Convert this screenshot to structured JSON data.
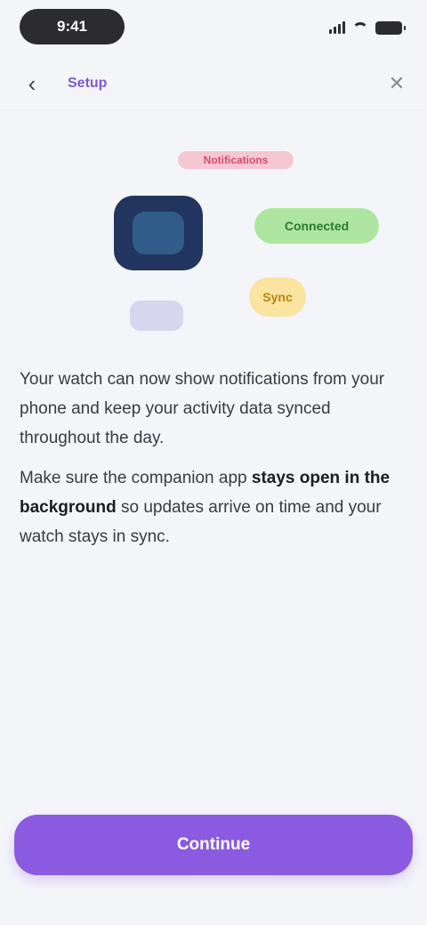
{
  "status_bar": {
    "time": "9:41"
  },
  "nav": {
    "title": "Setup"
  },
  "illustration": {
    "header_label": "Notifications",
    "feature_bar_label": "Connected",
    "feature_dot_label": "Sync"
  },
  "content": {
    "paragraph1": "Your watch can now show notifications from your phone and keep your activity data synced throughout the day.",
    "paragraph2_prefix": "Make sure the companion app ",
    "paragraph2_bold": "stays open in the background",
    "paragraph2_suffix": " so updates arrive on time and your watch stays in sync."
  },
  "footer": {
    "continue_label": "Continue"
  },
  "colors": {
    "accent": "#8a5be0",
    "background": "#f4f5f9"
  }
}
